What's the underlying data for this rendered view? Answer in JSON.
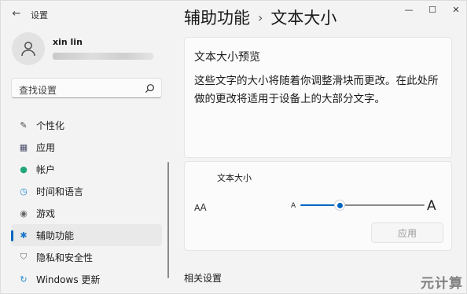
{
  "window": {
    "app_title": "设置",
    "back_glyph": "←",
    "controls": {
      "minimize": "—",
      "maximize": "☐",
      "close": "✕"
    }
  },
  "profile": {
    "name": "xin lin"
  },
  "search": {
    "placeholder": "查找设置"
  },
  "sidebar": {
    "items": [
      {
        "label": "个性化",
        "icon": "brush-icon",
        "glyph": "✎",
        "color": "#444444",
        "active": false
      },
      {
        "label": "应用",
        "icon": "apps-icon",
        "glyph": "▦",
        "color": "#4a4a6a",
        "active": false
      },
      {
        "label": "帐户",
        "icon": "account-icon",
        "glyph": "●",
        "color": "#21a67a",
        "active": false
      },
      {
        "label": "时间和语言",
        "icon": "globe-clock-icon",
        "glyph": "◷",
        "color": "#1e88d0",
        "active": false
      },
      {
        "label": "游戏",
        "icon": "gamepad-icon",
        "glyph": "◉",
        "color": "#666666",
        "active": false
      },
      {
        "label": "辅助功能",
        "icon": "accessibility-icon",
        "glyph": "✱",
        "color": "#1a73c8",
        "active": true
      },
      {
        "label": "隐私和安全性",
        "icon": "shield-icon",
        "glyph": "⛉",
        "color": "#666666",
        "active": false
      },
      {
        "label": "Windows 更新",
        "icon": "update-icon",
        "glyph": "↻",
        "color": "#1e88d0",
        "active": false
      }
    ]
  },
  "breadcrumb": {
    "parent": "辅助功能",
    "separator": "›",
    "current": "文本大小"
  },
  "preview": {
    "title": "文本大小预览",
    "text": "这些文字的大小将随着你调整滑块而更改。在此处所做的更改将适用于设备上的大部分文字。"
  },
  "text_size": {
    "label": "文本大小",
    "icon_text_small": "A",
    "icon_text_big": "A",
    "min_label": "A",
    "max_label": "A",
    "slider_value": 0.3,
    "apply_label": "应用"
  },
  "related": {
    "heading": "相关设置"
  },
  "watermark": "元计算",
  "colors": {
    "accent": "#0067c0",
    "background": "#f3f3f3",
    "card": "#fbfbfb"
  }
}
